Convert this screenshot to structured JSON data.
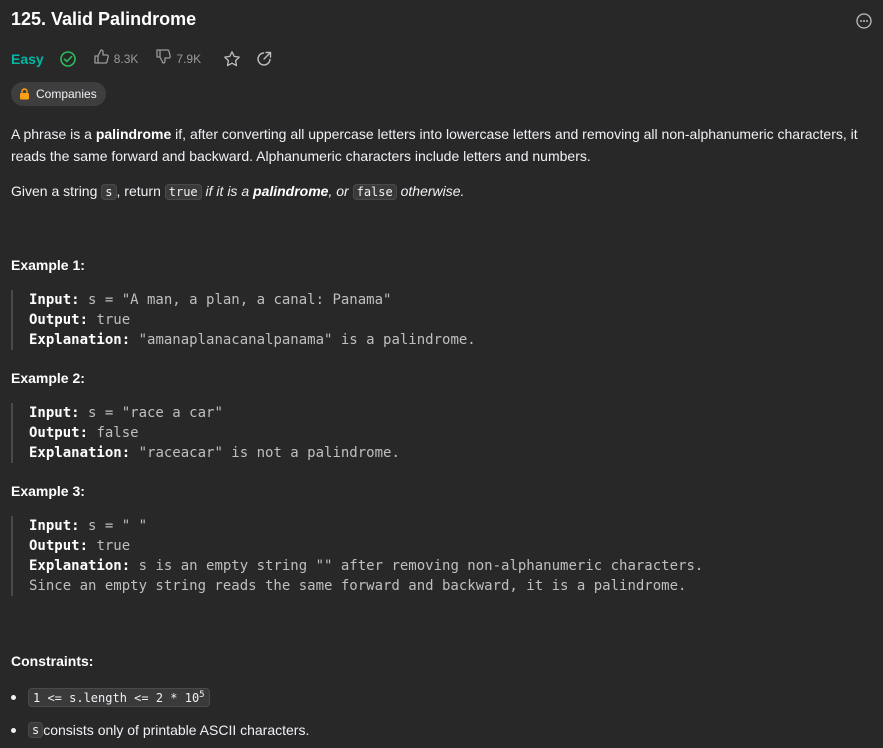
{
  "problem": {
    "title": "125. Valid Palindrome",
    "difficulty": "Easy",
    "likes": "8.3K",
    "dislikes": "7.9K",
    "companies_label": "Companies"
  },
  "description": {
    "p1_a": "A phrase is a ",
    "p1_b": "palindrome",
    "p1_c": " if, after converting all uppercase letters into lowercase letters and removing all non-alphanumeric characters, it reads the same forward and backward. Alphanumeric characters include letters and numbers.",
    "p2_a": "Given a string ",
    "p2_code_s": "s",
    "p2_b": ", return ",
    "p2_code_true": "true",
    "p2_c": " if it is a ",
    "p2_d": "palindrome",
    "p2_e": ", or ",
    "p2_code_false": "false",
    "p2_f": " otherwise."
  },
  "examples": [
    {
      "heading": "Example 1:",
      "input_label": "Input:",
      "input": " s = \"A man, a plan, a canal: Panama\"",
      "output_label": "Output:",
      "output": " true",
      "expl_label": "Explanation:",
      "expl": " \"amanaplanacanalpanama\" is a palindrome."
    },
    {
      "heading": "Example 2:",
      "input_label": "Input:",
      "input": " s = \"race a car\"",
      "output_label": "Output:",
      "output": " false",
      "expl_label": "Explanation:",
      "expl": " \"raceacar\" is not a palindrome."
    },
    {
      "heading": "Example 3:",
      "input_label": "Input:",
      "input": " s = \" \"",
      "output_label": "Output:",
      "output": " true",
      "expl_label": "Explanation:",
      "expl": " s is an empty string \"\" after removing non-alphanumeric characters.",
      "expl2": "Since an empty string reads the same forward and backward, it is a palindrome."
    }
  ],
  "constraints": {
    "heading": "Constraints:",
    "c1_code": "1 <= s.length <= 2 * 10",
    "c1_sup": "5",
    "c2_code": "s",
    "c2_text": " consists only of printable ASCII characters."
  },
  "colors": {
    "easy": "#00b8a3",
    "solved": "#2cbb5d",
    "background": "#282828"
  },
  "icons": [
    "solved-check-icon",
    "thumbs-up-icon",
    "thumbs-down-icon",
    "star-icon",
    "share-icon",
    "lock-icon",
    "more-options-icon"
  ]
}
